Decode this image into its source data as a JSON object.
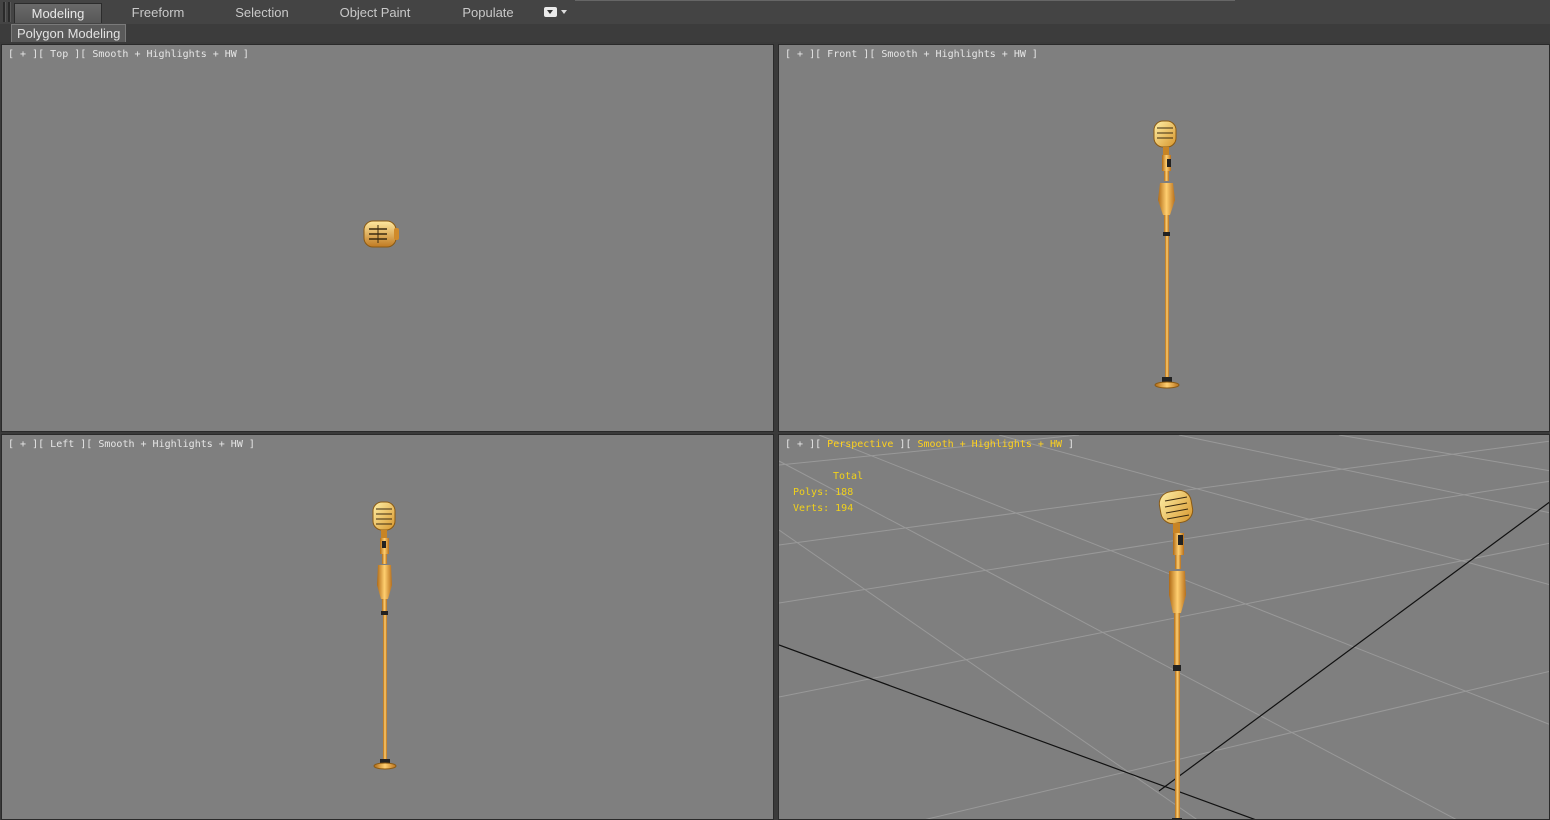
{
  "ribbon": {
    "tabs": [
      {
        "label": "Modeling",
        "active": true
      },
      {
        "label": "Freeform",
        "active": false
      },
      {
        "label": "Selection",
        "active": false
      },
      {
        "label": "Object Paint",
        "active": false
      },
      {
        "label": "Populate",
        "active": false
      }
    ],
    "toggle_icon": "ribbon-minimize-icon"
  },
  "panel": {
    "label": "Polygon Modeling"
  },
  "viewports": {
    "top": {
      "plus": "+",
      "view": "Top",
      "shading": "Smooth + Highlights + HW"
    },
    "front": {
      "plus": "+",
      "view": "Front",
      "shading": "Smooth + Highlights + HW"
    },
    "left": {
      "plus": "+",
      "view": "Left",
      "shading": "Smooth + Highlights + HW"
    },
    "perspective": {
      "plus": "+",
      "view": "Perspective",
      "shading": "Smooth + Highlights + HW"
    }
  },
  "stats": {
    "header": "Total",
    "polys_label": "Polys:",
    "polys_value": "188",
    "verts_label": "Verts:",
    "verts_value": "194"
  },
  "colors": {
    "viewport_bg": "#7f7f7f",
    "active_label": "#ffd21e",
    "stats_text": "#f2d21a",
    "model_gold": "#e6a43c"
  }
}
